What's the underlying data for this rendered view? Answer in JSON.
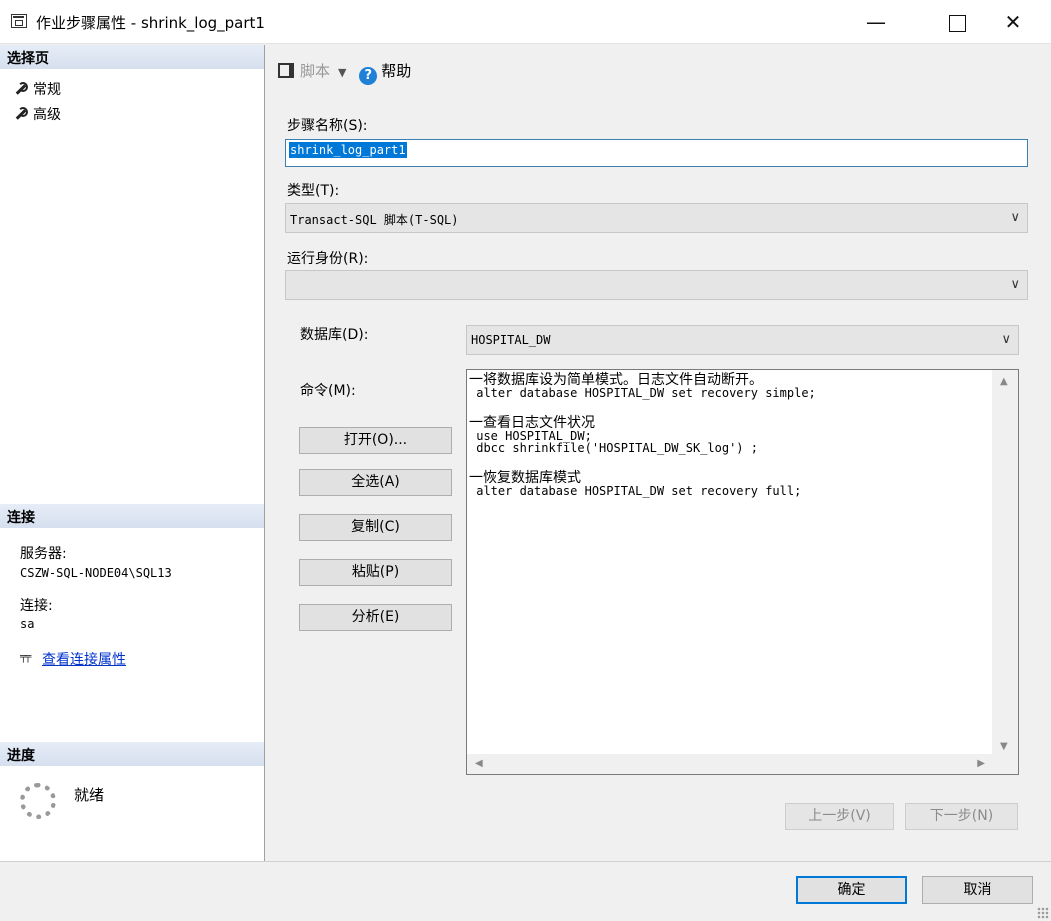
{
  "window": {
    "title": "作业步骤属性 - shrink_log_part1",
    "minimize": "—",
    "close": "✕"
  },
  "left_panel": {
    "select_page_header": "选择页",
    "pages": [
      {
        "label": "常规",
        "icon": "wrench-icon"
      },
      {
        "label": "高级",
        "icon": "wrench-icon"
      }
    ],
    "connection_header": "连接",
    "server_label": "服务器:",
    "server_value": "CSZW-SQL-NODE04\\SQL13",
    "connection_label": "连接:",
    "connection_value": "sa",
    "view_conn_props": "查看连接属性",
    "progress_header": "进度",
    "progress_status": "就绪"
  },
  "toolbar": {
    "script_label": "脚本",
    "help_label": "帮助"
  },
  "form": {
    "step_name_label": "步骤名称(S):",
    "step_name_value": "shrink_log_part1",
    "type_label": "类型(T):",
    "type_value": "Transact-SQL 脚本(T-SQL)",
    "run_as_label": "运行身份(R):",
    "run_as_value": "",
    "database_label": "数据库(D):",
    "database_value": "HOSPITAL_DW",
    "command_label": "命令(M):"
  },
  "command_buttons": {
    "open": "打开(O)...",
    "select_all": "全选(A)",
    "copy": "复制(C)",
    "paste": "粘贴(P)",
    "parse": "分析(E)"
  },
  "command_text": {
    "comment1": "一将数据库设为简单模式。日志文件自动断开。",
    "line1": " alter database HOSPITAL_DW set recovery simple;",
    "comment2": "一查看日志文件状况",
    "line2": " use HOSPITAL_DW;",
    "line3": " dbcc shrinkfile('HOSPITAL_DW_SK_log') ;",
    "comment3": "一恢复数据库模式",
    "line4": " alter database HOSPITAL_DW set recovery full;"
  },
  "navigation": {
    "prev": "上一步(V)",
    "next": "下一步(N)"
  },
  "footer": {
    "ok": "确定",
    "cancel": "取消"
  }
}
